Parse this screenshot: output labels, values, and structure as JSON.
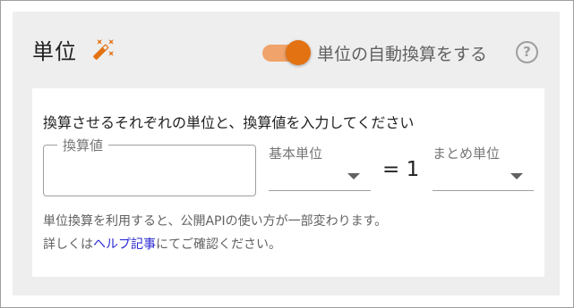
{
  "header": {
    "title": "単位",
    "edit_icon": "magic-wand-icon",
    "toggle_on": true,
    "toggle_label": "単位の自動換算をする",
    "help_glyph": "?",
    "accent_color": "#e37212"
  },
  "form": {
    "instruction": "換算させるそれぞれの単位と、換算値を入力してください",
    "conversion_value_label": "換算値",
    "conversion_value": "",
    "base_unit_label": "基本単位",
    "base_unit_value": "",
    "equals_text": "= 1",
    "bulk_unit_label": "まとめ単位",
    "bulk_unit_value": ""
  },
  "notes": {
    "line1": "単位換算を利用すると、公開APIの使い方が一部変わります。",
    "line2_prefix": "詳しくは",
    "line2_link": "ヘルプ記事",
    "line2_suffix": "にてご確認ください。"
  }
}
